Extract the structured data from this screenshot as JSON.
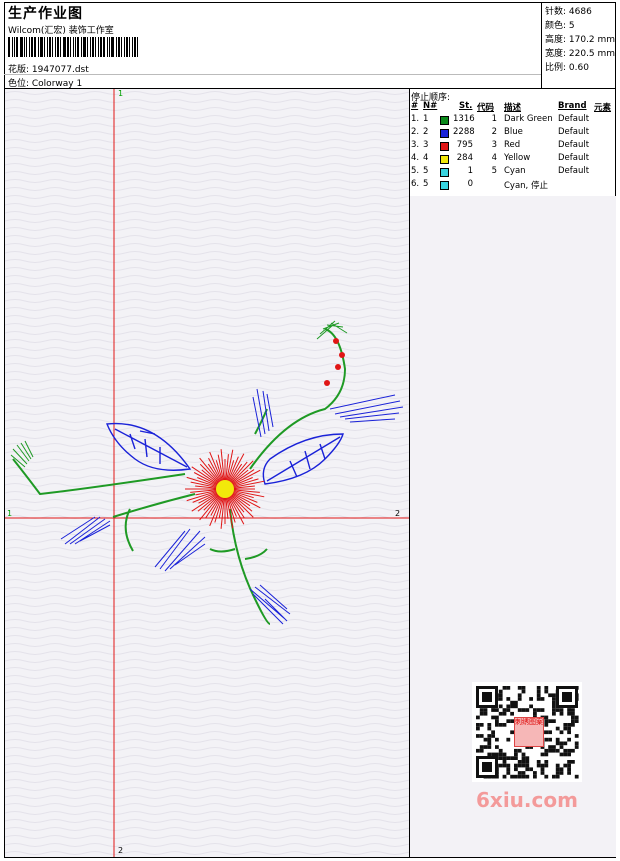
{
  "header": {
    "title": "生产作业图",
    "company": "Wilcom(汇宏) 装饰工作室",
    "design": "花版: 1947077.dst",
    "colorway": "色位: Colorway 1"
  },
  "stats": {
    "stitches": "针数: 4686",
    "colors": "颜色: 5",
    "height": "高度: 170.2 mm",
    "width": "宽度: 220.5 mm",
    "scale": "比例: 0.60"
  },
  "stop_sequence": {
    "title": "停止顺序:",
    "headers": {
      "num": "#",
      "n": "N#",
      "st": "St.",
      "code": "代码",
      "desc": "描述",
      "brand": "Brand",
      "elem": "元素"
    },
    "rows": [
      {
        "num": "1.",
        "n": "1",
        "color": "#0b8a1b",
        "st": "1316",
        "code": "1",
        "desc": "Dark Green",
        "brand": "Default"
      },
      {
        "num": "2.",
        "n": "2",
        "color": "#1a22d8",
        "st": "2288",
        "code": "2",
        "desc": "Blue",
        "brand": "Default"
      },
      {
        "num": "3.",
        "n": "3",
        "color": "#e01515",
        "st": "795",
        "code": "3",
        "desc": "Red",
        "brand": "Default"
      },
      {
        "num": "4.",
        "n": "4",
        "color": "#f2e80b",
        "st": "284",
        "code": "4",
        "desc": "Yellow",
        "brand": "Default"
      },
      {
        "num": "5.",
        "n": "5",
        "color": "#38d4e0",
        "st": "1",
        "code": "5",
        "desc": "Cyan",
        "brand": "Default"
      },
      {
        "num": "6.",
        "n": "5",
        "color": "#38d4e0",
        "st": "0",
        "code": "",
        "desc": "Cyan, 停止",
        "brand": ""
      }
    ]
  },
  "axes": {
    "x_start": "1",
    "x_end": "2",
    "y_start": "1",
    "y_end": "2"
  },
  "watermark": "6xiu.com",
  "qr_mark": "刺绣图案"
}
